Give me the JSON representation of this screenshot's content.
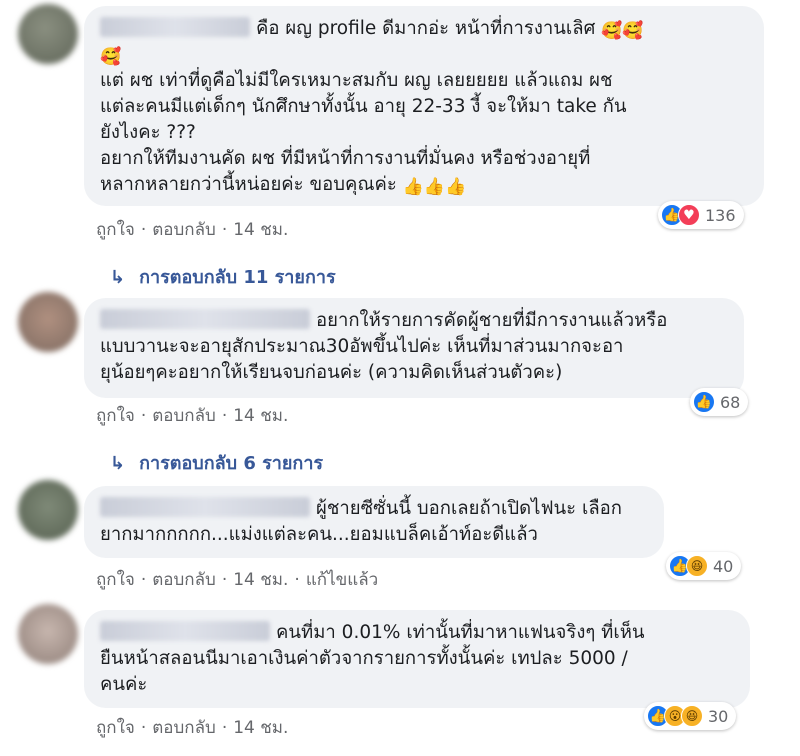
{
  "comments": [
    {
      "text_lines": [
        "คือ ผญ profile ดีมากอ่ะ หน้าที่การงานเลิศ",
        "แต่ ผช เท่าที่ดูคือไม่มีใครเหมาะสมกับ ผญ เลยยยยย แล้วแถม ผช",
        "แต่ละคนมีแต่เด็กๆ นักศึกษาทั้งนั้น อายุ 22-33 งี้ จะให้มา take กัน",
        "ยังไงคะ ???",
        "อยากให้ทีมงานคัด ผช ที่มีหน้าที่การงานที่มั่นคง หรือช่วงอายุที่",
        "หลากหลายกว่านี้หน่อยค่ะ ขอบคุณค่ะ"
      ],
      "emoji_inline": "🥰🥰",
      "emoji_line2": "🥰",
      "emoji_end": "👍👍👍",
      "actions": {
        "like": "ถูกใจ",
        "reply": "ตอบกลับ",
        "time": "14 ชม."
      },
      "reaction_count": "136",
      "reaction_icons": [
        "like-icon",
        "love-icon"
      ],
      "replies_label": "การตอบกลับ 11 รายการ"
    },
    {
      "text_lines": [
        "อยากให้รายการคัดผู้ชายที่มีการงานแล้วหรือ",
        "แบบวานะจะอายุสักประมาณ30อัพขึ้นไปค่ะ เห็นที่มาส่วนมากจะอา",
        "ยุน้อยๆคะอยากให้เรียนจบก่อนค่ะ (ความคิดเห็นส่วนตัวคะ)"
      ],
      "actions": {
        "like": "ถูกใจ",
        "reply": "ตอบกลับ",
        "time": "14 ชม."
      },
      "reaction_count": "68",
      "reaction_icons": [
        "like-icon"
      ],
      "replies_label": "การตอบกลับ 6 รายการ"
    },
    {
      "text_lines": [
        "ผู้ชายซีซั่นนี้ บอกเลยถ้าเปิดไฟนะ เลือก",
        "ยากมากกกกก...แม่งแต่ละคน...ยอมแบล็คเอ้าท์อะดีแล้ว"
      ],
      "actions": {
        "like": "ถูกใจ",
        "reply": "ตอบกลับ",
        "time": "14 ชม.",
        "edited": "แก้ไขแล้ว"
      },
      "reaction_count": "40",
      "reaction_icons": [
        "like-icon",
        "haha-icon"
      ]
    },
    {
      "text_lines": [
        "คนที่มา 0.01% เท่านั้นที่มาหาแฟนจริงๆ ที่เห็น",
        "ยืนหน้าสลอนนีมาเอาเงินค่าตัวจากรายการทั้งนั้นค่ะ เทปละ 5000 /",
        "คนค่ะ"
      ],
      "actions": {
        "like": "ถูกใจ",
        "reply": "ตอบกลับ",
        "time": "14 ชม."
      },
      "reaction_count": "30",
      "reaction_icons": [
        "like-icon",
        "wow-icon",
        "haha-icon"
      ]
    }
  ],
  "colors": {
    "bubble": "#f0f2f5",
    "link": "#385898",
    "meta": "#65676b",
    "like": "#1877f2",
    "love": "#f33e58",
    "haha": "#f7b125"
  }
}
